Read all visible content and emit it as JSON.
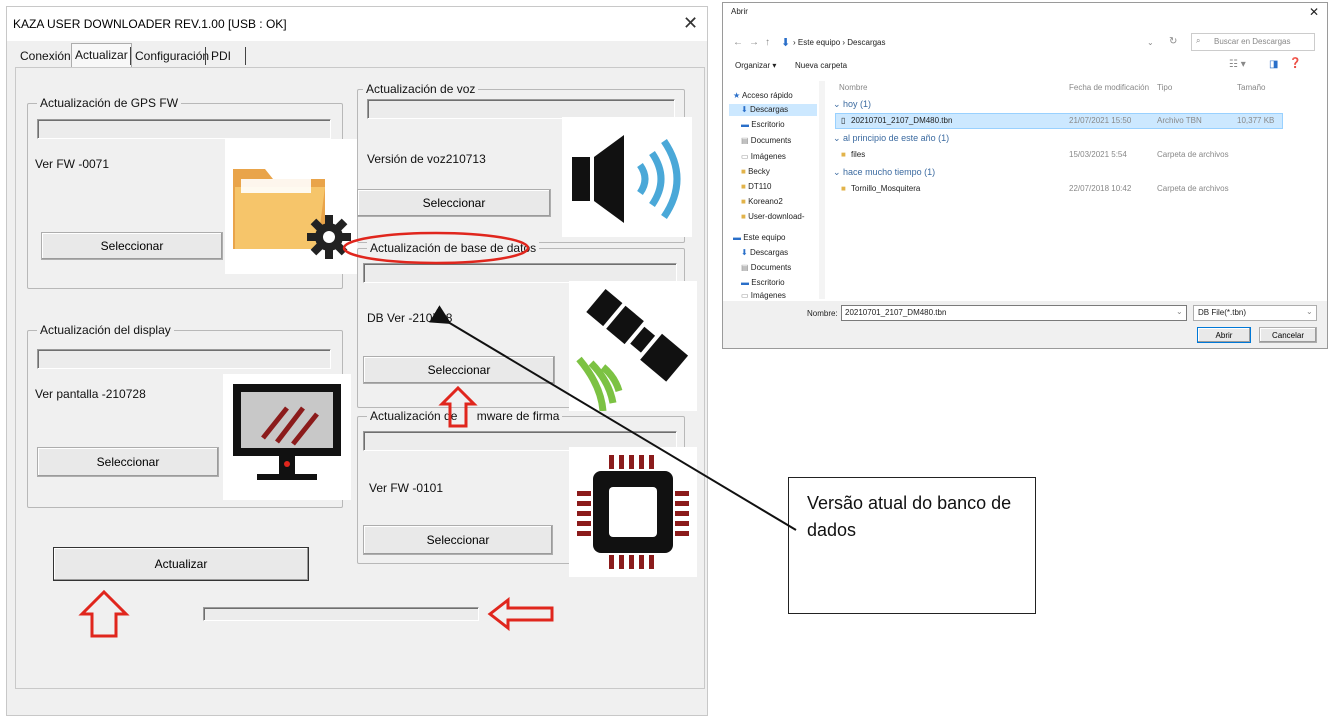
{
  "app": {
    "title": "KAZA USER DOWNLOADER REV.1.00 [USB : OK]",
    "tabs": [
      "Conexión",
      "Actualizar",
      "Configuración",
      "PDI"
    ],
    "active_tab": "Actualizar",
    "gps": {
      "title": "Actualización de GPS FW",
      "version": "Ver FW -0071",
      "button": "Seleccionar"
    },
    "voice": {
      "title": "Actualización de voz",
      "version": "Versión de voz210713",
      "button": "Seleccionar"
    },
    "database": {
      "title": "Actualización de base de datos",
      "version": "DB Ver -210728",
      "button": "Seleccionar"
    },
    "display": {
      "title": "Actualización del display",
      "version": "Ver pantalla -210728",
      "button": "Seleccionar"
    },
    "firmware": {
      "title_part1": "Actualización de ",
      "title_part2": "mware de firma",
      "version": "Ver FW -0101",
      "button": "Seleccionar"
    },
    "update_button": "Actualizar"
  },
  "dialog": {
    "title": "Abrir",
    "breadcrumb": [
      "Este equipo",
      "Descargas"
    ],
    "search_placeholder": "Buscar en Descargas",
    "toolbar": {
      "organize": "Organizar ▾",
      "new_folder": "Nueva carpeta"
    },
    "columns": [
      "Nombre",
      "Fecha de modificación",
      "Tipo",
      "Tamaño"
    ],
    "sidebar": {
      "quick_access": "Acceso rápido",
      "quick_items": [
        "Descargas",
        "Escritorio",
        "Documents",
        "Imágenes",
        "Becky",
        "DT110",
        "Koreano2",
        "User-download-"
      ],
      "this_pc": "Este equipo",
      "pc_items": [
        "Descargas",
        "Documents",
        "Escritorio",
        "Imágenes"
      ]
    },
    "groups": [
      {
        "header": "hoy (1)",
        "rows": [
          {
            "name": "20210701_2107_DM480.tbn",
            "date": "21/07/2021 15:50",
            "type": "Archivo TBN",
            "size": "10,377 KB",
            "selected": true
          }
        ]
      },
      {
        "header": "al principio de este año (1)",
        "rows": [
          {
            "name": "files",
            "date": "15/03/2021 5:54",
            "type": "Carpeta de archivos",
            "size": ""
          }
        ]
      },
      {
        "header": "hace mucho tiempo (1)",
        "rows": [
          {
            "name": "Tornillo_Mosquitera",
            "date": "22/07/2018 10:42",
            "type": "Carpeta de archivos",
            "size": ""
          }
        ]
      }
    ],
    "filename_label": "Nombre:",
    "filename_value": "20210701_2107_DM480.tbn",
    "filter": "DB File(*.tbn)",
    "open_button": "Abrir",
    "cancel_button": "Cancelar"
  },
  "note": {
    "text": "Versão atual do banco de dados"
  },
  "colors": {
    "accent_red": "#e0261d",
    "arrow": "#111111",
    "folder": "#f6c56a",
    "selection": "#cce8ff",
    "chip": "#8b1b1b"
  }
}
